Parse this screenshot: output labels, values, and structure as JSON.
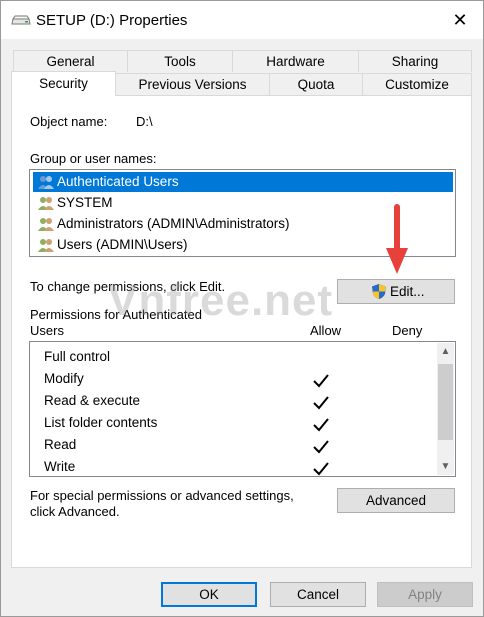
{
  "window": {
    "title": "SETUP (D:) Properties",
    "close_symbol": "✕"
  },
  "tabs": {
    "row1": [
      "General",
      "Tools",
      "Hardware",
      "Sharing"
    ],
    "row2": [
      "Security",
      "Previous Versions",
      "Quota",
      "Customize"
    ],
    "active": "Security"
  },
  "security": {
    "object_name_label": "Object name:",
    "object_name_value": "D:\\",
    "group_label": "Group or user names:",
    "users": [
      {
        "name": "Authenticated Users",
        "selected": true
      },
      {
        "name": "SYSTEM",
        "selected": false
      },
      {
        "name": "Administrators (ADMIN\\Administrators)",
        "selected": false
      },
      {
        "name": "Users (ADMIN\\Users)",
        "selected": false
      }
    ],
    "change_hint": "To change permissions, click Edit.",
    "edit_button": "Edit...",
    "permissions_label_line1": "Permissions for Authenticated",
    "permissions_label_line2": "Users",
    "allow_header": "Allow",
    "deny_header": "Deny",
    "permissions": [
      {
        "name": "Full control",
        "allow": false,
        "deny": false
      },
      {
        "name": "Modify",
        "allow": true,
        "deny": false
      },
      {
        "name": "Read & execute",
        "allow": true,
        "deny": false
      },
      {
        "name": "List folder contents",
        "allow": true,
        "deny": false
      },
      {
        "name": "Read",
        "allow": true,
        "deny": false
      },
      {
        "name": "Write",
        "allow": true,
        "deny": false
      }
    ],
    "advanced_hint_line1": "For special permissions or advanced settings,",
    "advanced_hint_line2": "click Advanced.",
    "advanced_button": "Advanced"
  },
  "footer": {
    "ok": "OK",
    "cancel": "Cancel",
    "apply": "Apply"
  },
  "watermark": "Vnfree.net",
  "colors": {
    "selection": "#0078d7",
    "arrow": "#e8403b",
    "panel_bg": "#f0f0f0"
  }
}
